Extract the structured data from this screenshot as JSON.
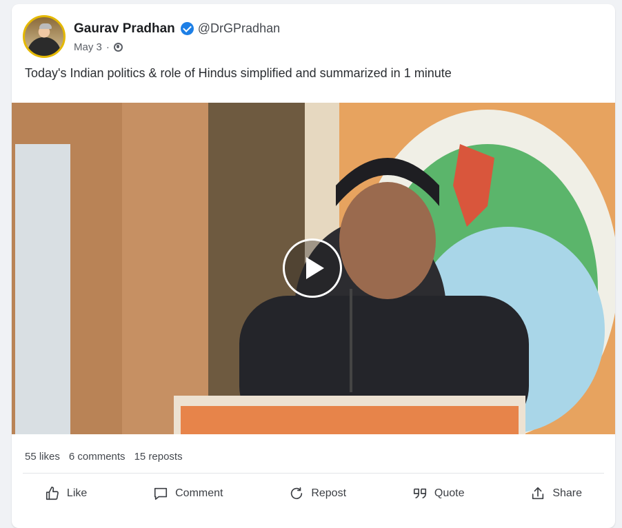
{
  "post": {
    "author_name": "Gaurav Pradhan",
    "author_handle": "@DrGPradhan",
    "date": "May 3",
    "separator": "·",
    "visibility_icon": "globe-icon",
    "text": "Today's Indian politics & role of Hindus simplified and summarized in 1 minute"
  },
  "video": {
    "play_icon": "play-icon"
  },
  "stats": {
    "likes": "55 likes",
    "comments": "6 comments",
    "reposts": "15 reposts"
  },
  "actions": [
    {
      "label": "Like",
      "icon": "thumbs-up-icon"
    },
    {
      "label": "Comment",
      "icon": "comment-icon"
    },
    {
      "label": "Repost",
      "icon": "repost-icon"
    },
    {
      "label": "Quote",
      "icon": "quote-icon"
    },
    {
      "label": "Share",
      "icon": "share-icon"
    }
  ],
  "colors": {
    "verified": "#1d7fe6",
    "avatar_ring": "#e4b800",
    "background": "#f0f2f5"
  }
}
